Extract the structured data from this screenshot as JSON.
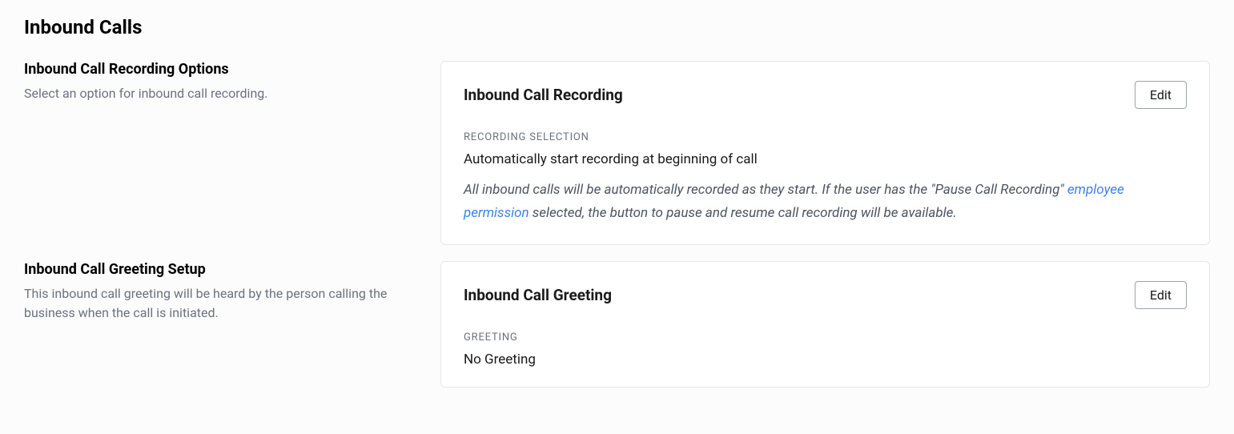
{
  "page_title": "Inbound Calls",
  "sections": {
    "recording": {
      "left_title": "Inbound Call Recording Options",
      "left_desc": "Select an option for inbound call recording.",
      "card_title": "Inbound Call Recording",
      "edit_label": "Edit",
      "field_label": "RECORDING SELECTION",
      "field_value": "Automatically start recording at beginning of call",
      "desc_part1": "All inbound calls will be automatically recorded as they start. If the user has the \"Pause Call Recording\" ",
      "desc_link": "employee permission",
      "desc_part2": " selected, the button to pause and resume call recording will be available."
    },
    "greeting": {
      "left_title": "Inbound Call Greeting Setup",
      "left_desc": "This inbound call greeting will be heard by the person calling the business when the call is initiated.",
      "card_title": "Inbound Call Greeting",
      "edit_label": "Edit",
      "field_label": "GREETING",
      "field_value": "No Greeting"
    }
  }
}
